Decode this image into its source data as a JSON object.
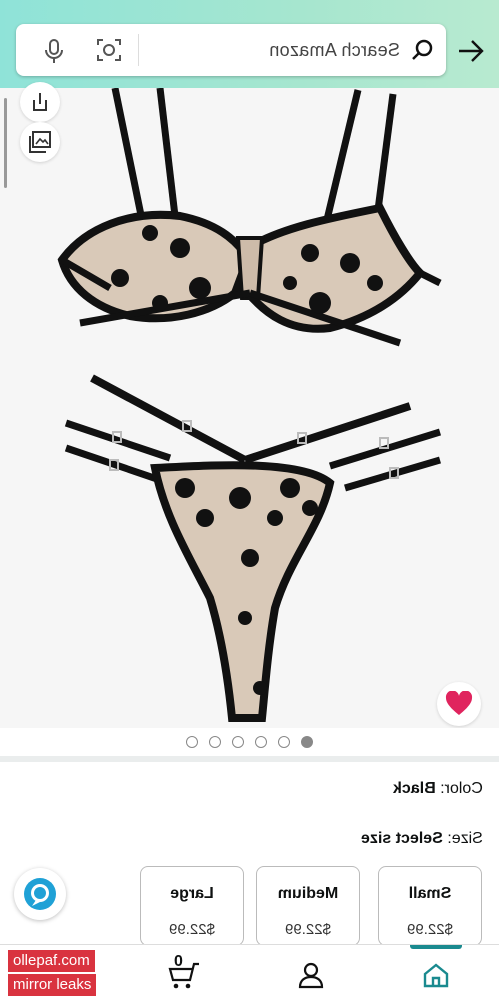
{
  "search": {
    "placeholder": "Search Amazon"
  },
  "icons": {
    "mic": "microphone-icon",
    "camera": "camera-scan-icon",
    "search": "search-icon",
    "forward": "arrow-right-icon",
    "share": "share-icon",
    "gallery": "image-gallery-icon",
    "heart": "heart-icon",
    "alexa": "alexa-icon",
    "cart": "cart-icon",
    "account": "account-icon",
    "home": "home-icon"
  },
  "gallery": {
    "image_count": 6,
    "active_index": 5
  },
  "product": {
    "color_label": "Color: ",
    "color_value": "Black",
    "size_label": "Size: ",
    "size_value": "Select size",
    "sizes": [
      {
        "name": "Small",
        "price": "$22.99"
      },
      {
        "name": "Medium",
        "price": "$22.99"
      },
      {
        "name": "Large",
        "price": "$22.99"
      }
    ]
  },
  "nav": {
    "cart_count": "0"
  },
  "watermark": {
    "line1": "ollepaf.com",
    "line2": "mirror leaks"
  },
  "colors": {
    "header_start": "#8fe3d8",
    "accent": "#1a8a8f",
    "heart": "#e0245e",
    "watermark": "#d9333f"
  }
}
